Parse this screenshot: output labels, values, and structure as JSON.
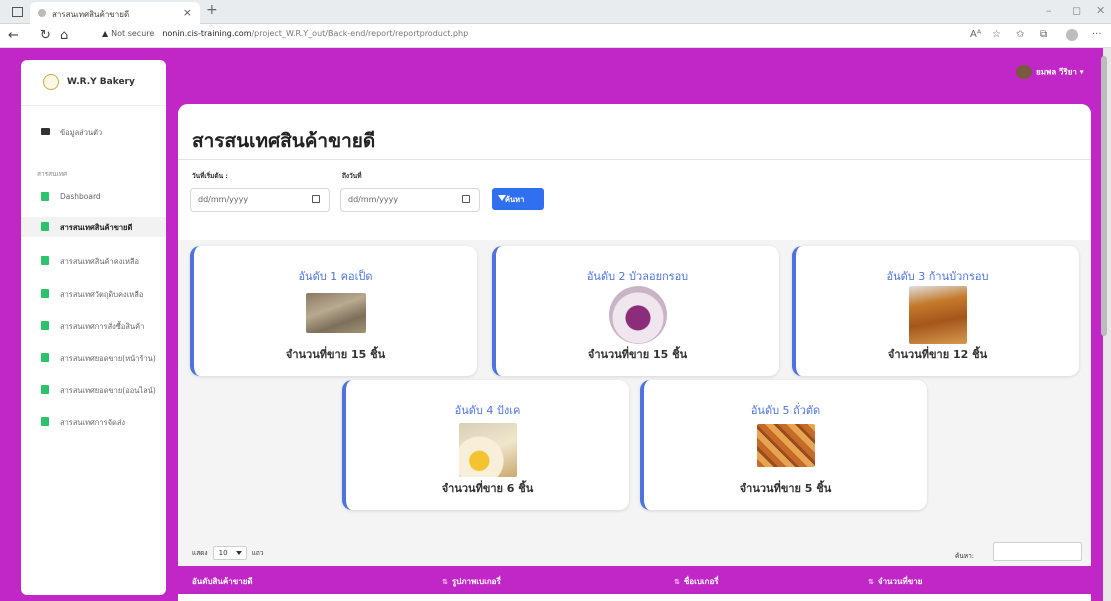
{
  "browser": {
    "tab_title": "สารสนเทศสินค้าขายดี",
    "not_secure": "Not secure",
    "url_host": "nonin.cis-training.com",
    "url_path": "/project_W.R.Y_out/Back-end/report/reportproduct.php",
    "read_aloud": "Aᴬ"
  },
  "sidebar": {
    "brand": "W.R.Y Bakery",
    "profile_item": "ข้อมูลส่วนตัว",
    "section_label": "สารสนเทศ",
    "items": [
      {
        "label": "Dashboard",
        "active": false
      },
      {
        "label": "สารสนเทศสินค้าขายดี",
        "active": true
      },
      {
        "label": "สารสนเทศสินค้าคงเหลือ",
        "active": false
      },
      {
        "label": "สารสนเทศวัตถุดิบคงเหลือ",
        "active": false
      },
      {
        "label": "สารสนเทศการสั่งซื้อสินค้า",
        "active": false
      },
      {
        "label": "สารสนเทศยอดขาย(หน้าร้าน)",
        "active": false
      },
      {
        "label": "สารสนเทศยอดขาย(ออนไลน์)",
        "active": false
      },
      {
        "label": "สารสนเทศการจัดส่ง",
        "active": false
      }
    ]
  },
  "header": {
    "user_name": "ยมพล วีริยา ▾"
  },
  "page": {
    "title": "สารสนเทศสินค้าขายดี",
    "start_label": "วันที่เริ่มต้น :",
    "end_label": "ถึงวันที่",
    "date_placeholder": "dd/mm/yyyy",
    "search_button": "ค้นหา"
  },
  "cards": [
    {
      "rank": "อันดับ 1 คอเป็ด",
      "sold": "จำนวนที่ขาย 15 ชิ้น"
    },
    {
      "rank": "อันดับ 2 บัวลอยกรอบ",
      "sold": "จำนวนที่ขาย 15 ชิ้น"
    },
    {
      "rank": "อันดับ 3 ก้านบัวกรอบ",
      "sold": "จำนวนที่ขาย 12 ชิ้น"
    },
    {
      "rank": "อันดับ 4 ปังเค",
      "sold": "จำนวนที่ขาย 6 ชิ้น"
    },
    {
      "rank": "อันดับ 5 ถั่วตัด",
      "sold": "จำนวนที่ขาย 5 ชิ้น"
    }
  ],
  "table": {
    "show_prefix": "แสดง",
    "page_size": "10",
    "show_suffix": "แถว",
    "search_label": "ค้นหา:",
    "columns": [
      "อันดับสินค้าขายดี",
      "รูปภาพเบเกอรี่",
      "ชื่อเบเกอรี่",
      "จำนวนที่ขาย"
    ]
  },
  "colors": {
    "accent": "#c126c6",
    "primary": "#4e73df",
    "button": "#2f6ff0"
  }
}
